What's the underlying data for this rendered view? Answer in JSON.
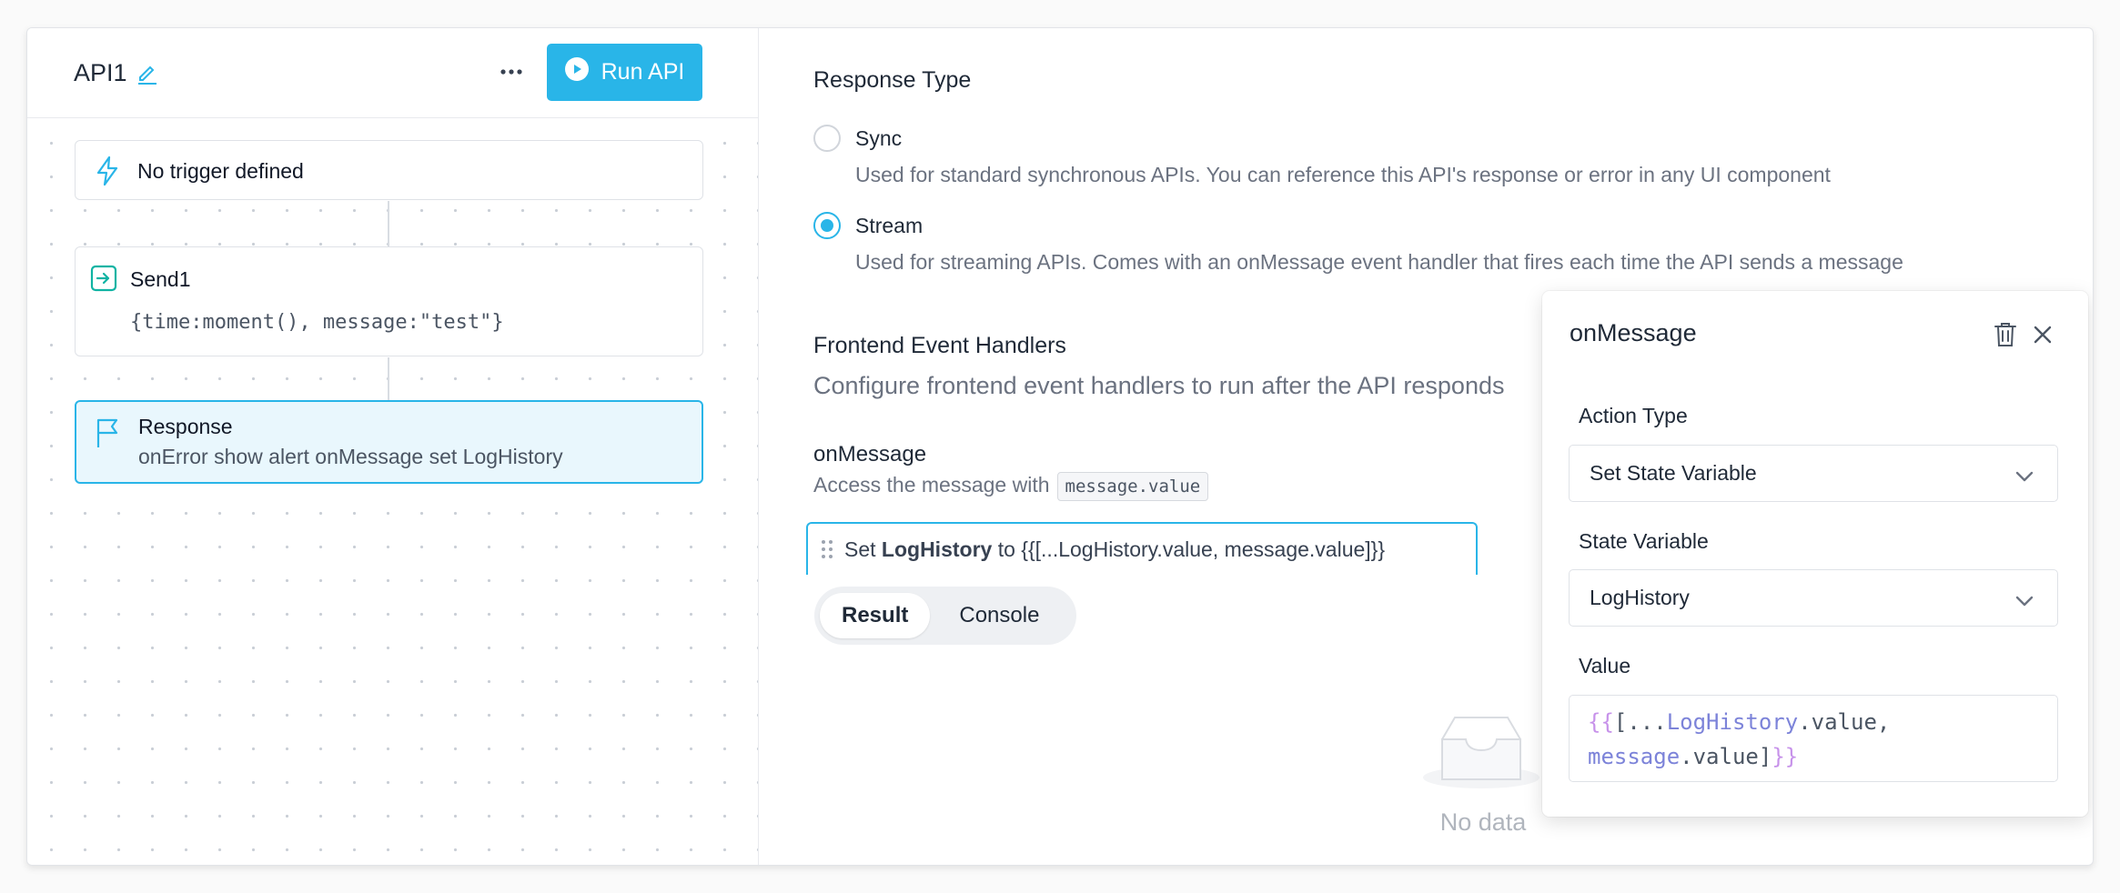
{
  "header": {
    "api_name": "API1",
    "run_label": "Run API"
  },
  "nodes": {
    "trigger": {
      "label": "No trigger defined"
    },
    "send": {
      "title": "Send1",
      "payload": "{time:moment(), message:\"test\"}"
    },
    "response": {
      "title": "Response",
      "subtitle": "onError show alert onMessage set LogHistory"
    }
  },
  "response_type": {
    "title": "Response Type",
    "options": [
      {
        "label": "Sync",
        "description": "Used for standard synchronous APIs. You can reference this API's response or error in any UI component",
        "checked": false
      },
      {
        "label": "Stream",
        "description": "Used for streaming APIs. Comes with an onMessage event handler that fires each time the API sends a message",
        "checked": true
      }
    ]
  },
  "frontend_handlers": {
    "title": "Frontend Event Handlers",
    "description": "Configure frontend event handlers to run after the API responds",
    "handler_name": "onMessage",
    "access_text": "Access the message with",
    "access_code": "message.value",
    "row": {
      "prefix": "Set",
      "variable": "LogHistory",
      "middle": "to",
      "expression": "{{[...LogHistory.value, message.value]}}"
    }
  },
  "tabs": [
    {
      "label": "Result",
      "active": true
    },
    {
      "label": "Console",
      "active": false
    }
  ],
  "empty_state": {
    "text": "No data"
  },
  "popover": {
    "title": "onMessage",
    "action_type": {
      "label": "Action Type",
      "value": "Set State Variable"
    },
    "state_variable": {
      "label": "State Variable",
      "value": "LogHistory"
    },
    "value": {
      "label": "Value",
      "open": "{{",
      "bracket": "[...",
      "var1": "LogHistory",
      "prop1": ".value,",
      "var2": "message",
      "prop2": ".value]",
      "close": "}}"
    }
  },
  "colors": {
    "accent": "#29b5e8",
    "send_icon": "#10b3a3",
    "border": "#dfe2e7",
    "muted_text": "#6b7280"
  },
  "icons": [
    "edit-icon",
    "more-icon",
    "play-icon",
    "lightning-icon",
    "send-icon",
    "flag-icon",
    "drag-handle-icon",
    "inbox-icon",
    "trash-icon",
    "close-icon",
    "chevron-down-icon"
  ]
}
